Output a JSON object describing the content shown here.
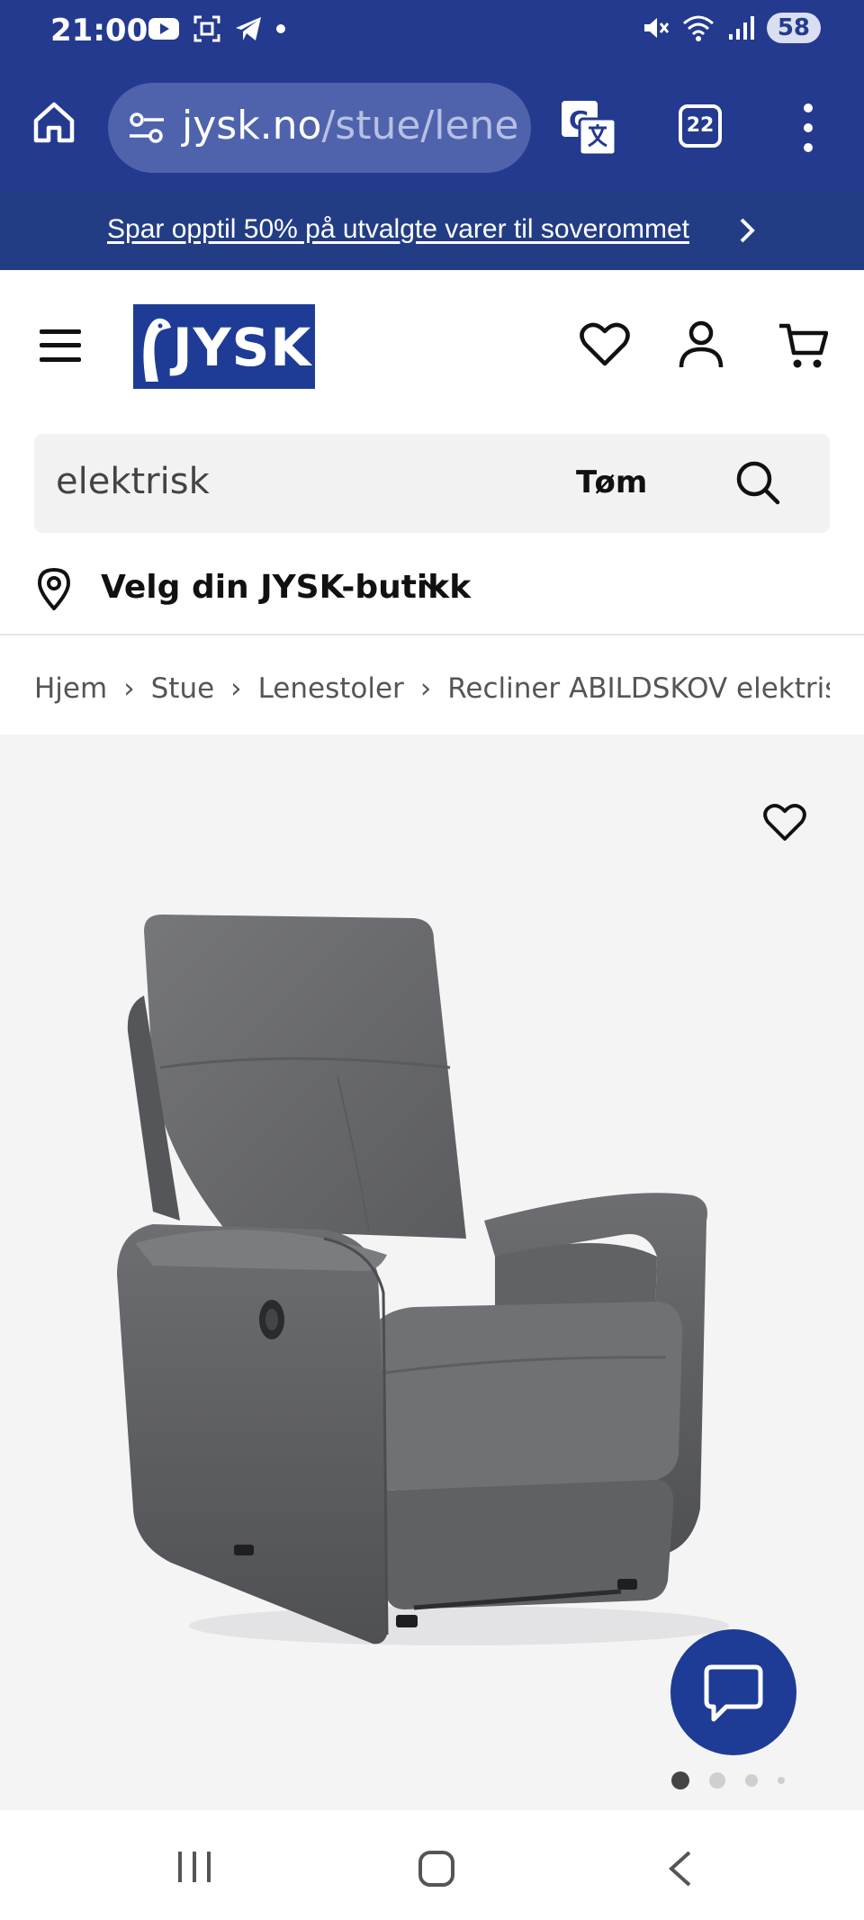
{
  "status_bar": {
    "time": "21:00",
    "battery": "58"
  },
  "browser": {
    "url_host": "jysk.no",
    "url_path": "/stue/lene",
    "tabs_count": "22"
  },
  "promo": {
    "text": "Spar opptil 50% på utvalgte varer til soverommet"
  },
  "header": {
    "logo_text": "JYSK"
  },
  "search": {
    "value": "elektrisk",
    "clear_label": "Tøm"
  },
  "store": {
    "label": "Velg din JYSK-butikk"
  },
  "breadcrumb": {
    "items": [
      "Hjem",
      "Stue",
      "Lenestoler",
      "Recliner ABILDSKOV elektrisk grå"
    ]
  },
  "gallery": {
    "active_index": 0,
    "image_count": 4
  },
  "colors": {
    "brand_blue": "#1e3c96",
    "chrome_blue": "#243a8f",
    "promo_blue": "#233d85"
  },
  "icons": [
    "home-icon",
    "site-settings-icon",
    "translate-icon",
    "more-vert-icon",
    "chevron-right-icon",
    "menu-icon",
    "heart-icon",
    "user-icon",
    "cart-icon",
    "search-icon",
    "location-pin-icon",
    "chevron-down-icon",
    "chat-icon"
  ]
}
